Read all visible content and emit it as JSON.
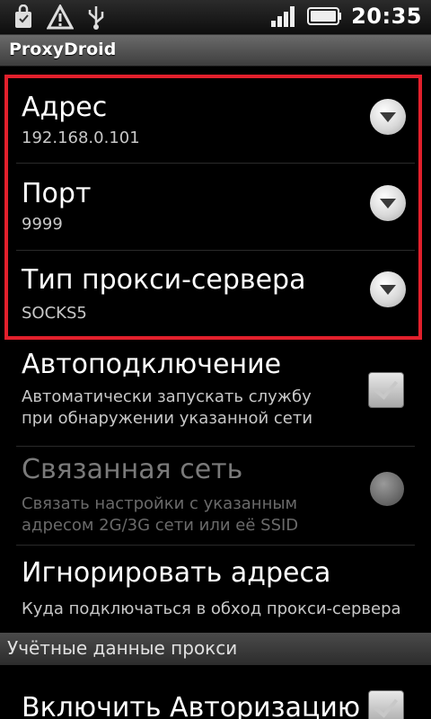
{
  "status_bar": {
    "time": "20:35",
    "icons": [
      "bag-icon",
      "warning-icon",
      "usb-icon",
      "signal-icon",
      "battery-icon"
    ]
  },
  "app": {
    "title": "ProxyDroid"
  },
  "preferences": [
    {
      "title": "Адрес",
      "summary": "192.168.0.101",
      "control": "dropdown"
    },
    {
      "title": "Порт",
      "summary": "9999",
      "control": "dropdown"
    },
    {
      "title": "Тип прокси-сервера",
      "summary": "SOCKS5",
      "control": "dropdown"
    },
    {
      "title": "Автоподключение",
      "summary_line1": "Автоматически запускать службу",
      "summary_line2": "при обнаружении указанной сети",
      "control": "checkbox"
    },
    {
      "title": "Связанная сеть",
      "summary_line1": "Связать настройки с указанным",
      "summary_line2": "адресом 2G/3G сети или её SSID",
      "control": "radio",
      "disabled": true
    },
    {
      "title": "Игнорировать адреса",
      "summary": "Куда подключаться в обход прокси-сервера"
    }
  ],
  "category": {
    "label": "Учётные данные прокси"
  },
  "last_item": {
    "title": "Включить Авторизацию"
  },
  "colors": {
    "highlight": "#e2202c",
    "background": "#000000"
  }
}
